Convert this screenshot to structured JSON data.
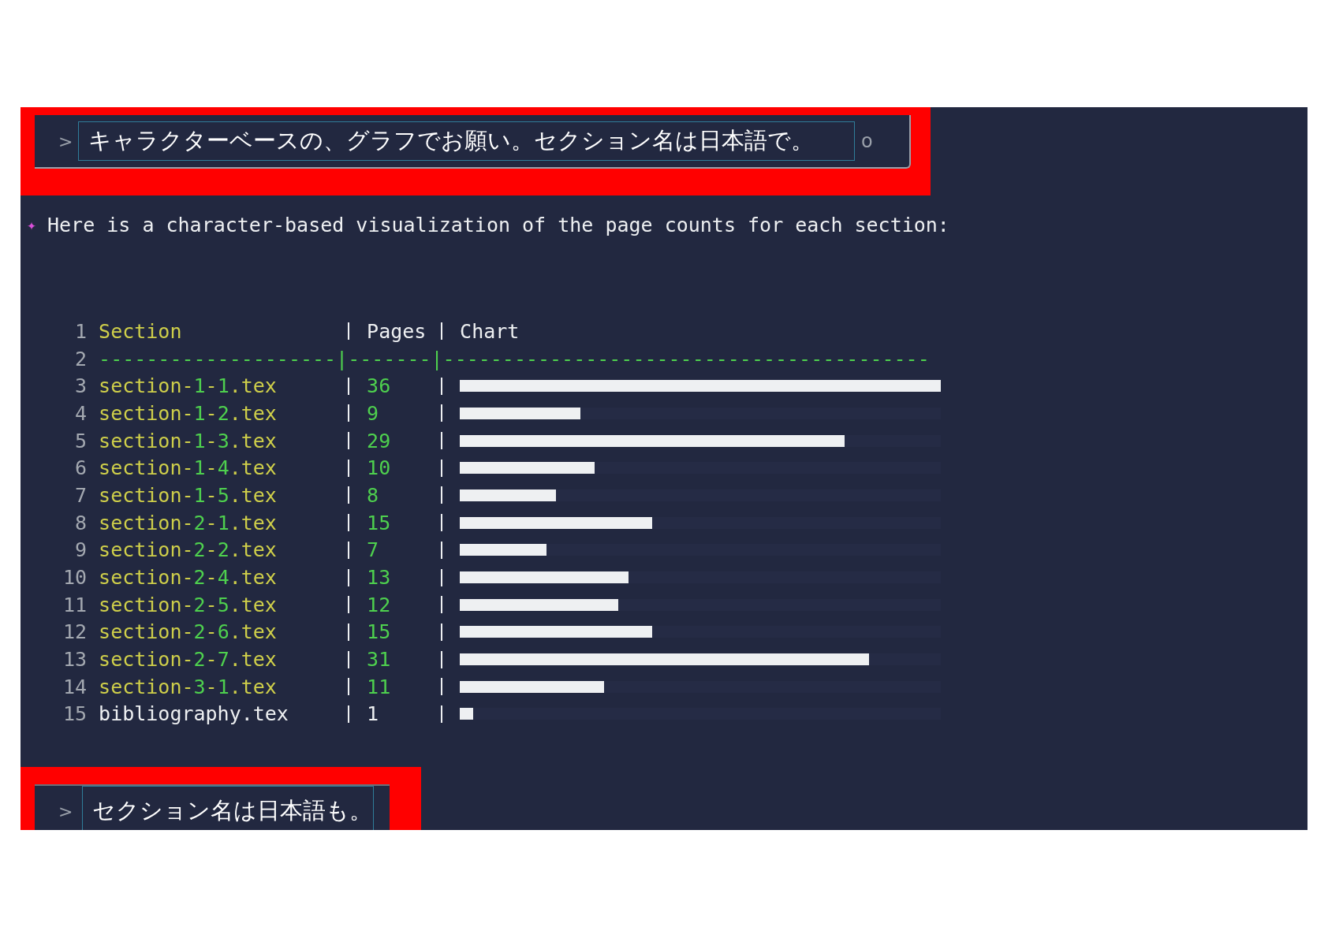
{
  "prompt": {
    "symbol": ">",
    "value": "キャラクターベースの、グラフでお願い。セクション名は日本語で。",
    "trailing": "o"
  },
  "response": {
    "symbol": "✦",
    "text": "Here is a character-based visualization of the page counts for each section:"
  },
  "table": {
    "header": {
      "line": "1",
      "section": "Section",
      "pages": "Pages",
      "chart": "Chart"
    },
    "separator": {
      "line": "2",
      "text": "--------------------|-------|-----------------------------------------"
    },
    "rows": [
      {
        "line": "3",
        "section": [
          {
            "text": "section-",
            "kind": "name"
          },
          {
            "text": "1",
            "kind": "num"
          },
          {
            "text": "-",
            "kind": "name"
          },
          {
            "text": "1",
            "kind": "num"
          },
          {
            "text": ".tex",
            "kind": "name"
          }
        ],
        "pages": {
          "text": "36",
          "kind": "num"
        },
        "level": 1
      },
      {
        "line": "4",
        "section": [
          {
            "text": "section-",
            "kind": "name"
          },
          {
            "text": "1",
            "kind": "num"
          },
          {
            "text": "-",
            "kind": "name"
          },
          {
            "text": "2",
            "kind": "num"
          },
          {
            "text": ".tex",
            "kind": "name"
          }
        ],
        "pages": {
          "text": "9",
          "kind": "num"
        },
        "level": 0.25
      },
      {
        "line": "5",
        "section": [
          {
            "text": "section-",
            "kind": "name"
          },
          {
            "text": "1",
            "kind": "num"
          },
          {
            "text": "-",
            "kind": "name"
          },
          {
            "text": "3",
            "kind": "num"
          },
          {
            "text": ".tex",
            "kind": "name"
          }
        ],
        "pages": {
          "text": "29",
          "kind": "num"
        },
        "level": 0.8
      },
      {
        "line": "6",
        "section": [
          {
            "text": "section-",
            "kind": "name"
          },
          {
            "text": "1",
            "kind": "num"
          },
          {
            "text": "-",
            "kind": "name"
          },
          {
            "text": "4",
            "kind": "num"
          },
          {
            "text": ".tex",
            "kind": "name"
          }
        ],
        "pages": {
          "text": "10",
          "kind": "num"
        },
        "level": 0.28
      },
      {
        "line": "7",
        "section": [
          {
            "text": "section-",
            "kind": "name"
          },
          {
            "text": "1",
            "kind": "num"
          },
          {
            "text": "-",
            "kind": "name"
          },
          {
            "text": "5",
            "kind": "num"
          },
          {
            "text": ".tex",
            "kind": "name"
          }
        ],
        "pages": {
          "text": "8",
          "kind": "num"
        },
        "level": 0.2
      },
      {
        "line": "8",
        "section": [
          {
            "text": "section-",
            "kind": "name"
          },
          {
            "text": "2",
            "kind": "num"
          },
          {
            "text": "-",
            "kind": "name"
          },
          {
            "text": "1",
            "kind": "num"
          },
          {
            "text": ".tex",
            "kind": "name"
          }
        ],
        "pages": {
          "text": "15",
          "kind": "num"
        },
        "level": 0.4
      },
      {
        "line": "9",
        "section": [
          {
            "text": "section-",
            "kind": "name"
          },
          {
            "text": "2",
            "kind": "num"
          },
          {
            "text": "-",
            "kind": "name"
          },
          {
            "text": "2",
            "kind": "num"
          },
          {
            "text": ".tex",
            "kind": "name"
          }
        ],
        "pages": {
          "text": "7",
          "kind": "num"
        },
        "level": 0.18
      },
      {
        "line": "10",
        "section": [
          {
            "text": "section-",
            "kind": "name"
          },
          {
            "text": "2",
            "kind": "num"
          },
          {
            "text": "-",
            "kind": "name"
          },
          {
            "text": "4",
            "kind": "num"
          },
          {
            "text": ".tex",
            "kind": "name"
          }
        ],
        "pages": {
          "text": "13",
          "kind": "num"
        },
        "level": 0.35
      },
      {
        "line": "11",
        "section": [
          {
            "text": "section-",
            "kind": "name"
          },
          {
            "text": "2",
            "kind": "num"
          },
          {
            "text": "-",
            "kind": "name"
          },
          {
            "text": "5",
            "kind": "num"
          },
          {
            "text": ".tex",
            "kind": "name"
          }
        ],
        "pages": {
          "text": "12",
          "kind": "num"
        },
        "level": 0.33
      },
      {
        "line": "12",
        "section": [
          {
            "text": "section-",
            "kind": "name"
          },
          {
            "text": "2",
            "kind": "num"
          },
          {
            "text": "-",
            "kind": "name"
          },
          {
            "text": "6",
            "kind": "num"
          },
          {
            "text": ".tex",
            "kind": "name"
          }
        ],
        "pages": {
          "text": "15",
          "kind": "num"
        },
        "level": 0.4
      },
      {
        "line": "13",
        "section": [
          {
            "text": "section-",
            "kind": "name"
          },
          {
            "text": "2",
            "kind": "num"
          },
          {
            "text": "-",
            "kind": "name"
          },
          {
            "text": "7",
            "kind": "num"
          },
          {
            "text": ".tex",
            "kind": "name"
          }
        ],
        "pages": {
          "text": "31",
          "kind": "num"
        },
        "level": 0.85
      },
      {
        "line": "14",
        "section": [
          {
            "text": "section-",
            "kind": "name"
          },
          {
            "text": "3",
            "kind": "num"
          },
          {
            "text": "-",
            "kind": "name"
          },
          {
            "text": "1",
            "kind": "num"
          },
          {
            "text": ".tex",
            "kind": "name"
          }
        ],
        "pages": {
          "text": "11",
          "kind": "num"
        },
        "level": 0.3
      },
      {
        "line": "15",
        "section": [
          {
            "text": "bibliography.tex",
            "kind": "plain"
          }
        ],
        "pages": {
          "text": "1",
          "kind": "plain"
        },
        "level": 0.028
      }
    ]
  },
  "next_prompt": {
    "symbol": ">",
    "value": "セクション名は日本語も。"
  }
}
